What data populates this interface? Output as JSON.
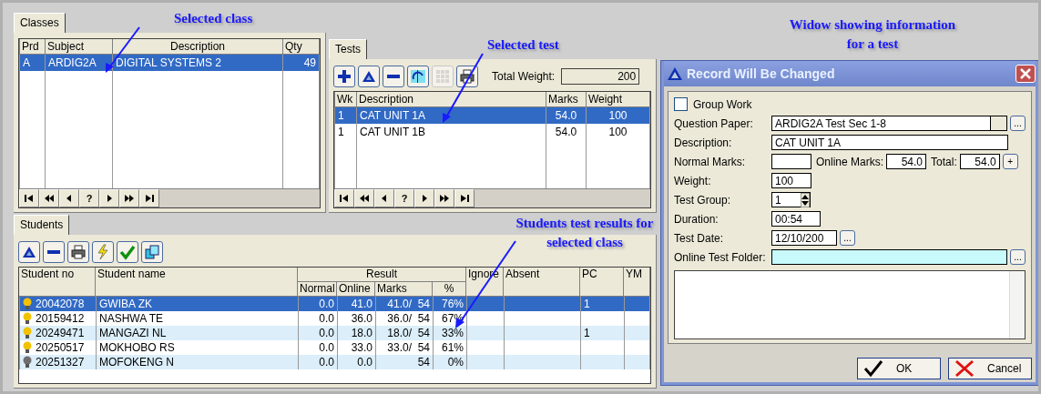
{
  "annotations": [
    {
      "text": "Selected class"
    },
    {
      "text": "Selected test"
    },
    {
      "text": "Widow showing information for a test"
    },
    {
      "text": "Students test results for selected class"
    }
  ],
  "classes": {
    "tab": {
      "label": "Classes",
      "selected": true
    },
    "columns": [
      "Prd",
      "Subject",
      "Description",
      "Qty"
    ],
    "rows": [
      {
        "cells": [
          "A",
          "ARDIG2A",
          "DIGITAL SYSTEMS 2",
          "49"
        ],
        "selected": true
      }
    ],
    "nav": [
      {
        "kind": "first"
      },
      {
        "kind": "prev-page"
      },
      {
        "kind": "prev"
      },
      {
        "kind": "find",
        "label": "?"
      },
      {
        "kind": "next"
      },
      {
        "kind": "next-page"
      },
      {
        "kind": "last"
      }
    ]
  },
  "tests": {
    "tab": {
      "label": "Tests",
      "selected": true
    },
    "toolbar": [
      {
        "kind": "add",
        "disabled": false
      },
      {
        "kind": "edit",
        "disabled": false
      },
      {
        "kind": "delete",
        "disabled": false
      },
      {
        "kind": "swap",
        "disabled": false
      },
      {
        "kind": "grid",
        "disabled": true
      },
      {
        "kind": "print",
        "disabled": false
      }
    ],
    "total_weight": {
      "label": "Total Weight:",
      "value": "200"
    },
    "columns": [
      "Wk",
      "Description",
      "Marks",
      "Weight"
    ],
    "rows": [
      {
        "cells": [
          "1",
          "CAT UNIT 1A",
          "54.0",
          "100"
        ],
        "selected": true
      },
      {
        "cells": [
          "1",
          "CAT UNIT 1B",
          "54.0",
          "100"
        ],
        "selected": false
      }
    ],
    "nav": [
      {
        "kind": "first"
      },
      {
        "kind": "prev-page"
      },
      {
        "kind": "prev"
      },
      {
        "kind": "find",
        "label": "?"
      },
      {
        "kind": "next"
      },
      {
        "kind": "next-page"
      },
      {
        "kind": "last"
      }
    ]
  },
  "students": {
    "tab": {
      "label": "Students",
      "selected": true
    },
    "toolbar": [
      {
        "kind": "edit"
      },
      {
        "kind": "delete"
      },
      {
        "kind": "print"
      },
      {
        "kind": "lightning"
      },
      {
        "kind": "check"
      },
      {
        "kind": "copy"
      }
    ],
    "columns": {
      "student_no": "Student no",
      "student_name": "Student name",
      "result": "Result",
      "normal": "Normal",
      "online": "Online",
      "marks": "Marks",
      "percent": "%",
      "ignore": "Ignore",
      "absent": "Absent",
      "pc": "PC",
      "ym": "YM"
    },
    "rows": [
      {
        "color": "#f2c200",
        "selected": true,
        "cells": [
          "20042078",
          "GWIBA  ZK",
          "0.0",
          "41.0",
          "41.0/  54",
          "76%",
          "",
          "",
          "1",
          ""
        ]
      },
      {
        "color": "#f2c200",
        "selected": false,
        "cells": [
          "20159412",
          "NASHWA TE",
          "0.0",
          "36.0",
          "36.0/  54",
          "67%",
          "",
          "",
          "",
          ""
        ]
      },
      {
        "color": "#f2c200",
        "selected": false,
        "cells": [
          "20249471",
          "MANGAZI  NL",
          "0.0",
          "18.0",
          "18.0/  54",
          "33%",
          "",
          "",
          "1",
          ""
        ]
      },
      {
        "color": "#f2c200",
        "selected": false,
        "cells": [
          "20250517",
          "MOKHOBO  RS",
          "0.0",
          "33.0",
          "33.0/  54",
          "61%",
          "",
          "",
          "",
          ""
        ]
      },
      {
        "color": "#6e6e6e",
        "selected": false,
        "cells": [
          "20251327",
          "MOFOKENG  N",
          "0.0",
          "0.0",
          "54",
          "0%",
          "",
          "",
          "",
          ""
        ]
      }
    ]
  },
  "dialog": {
    "title": "Record Will Be Changed",
    "group_work": {
      "label": "Group Work",
      "checked": false
    },
    "question_paper": {
      "label": "Question Paper:",
      "value": "ARDIG2A Test Sec 1-8"
    },
    "description": {
      "label": "Description:",
      "value": "CAT UNIT 1A"
    },
    "normal_marks": {
      "label": "Normal Marks:"
    },
    "online_marks": {
      "label": "Online Marks:",
      "value": "54.0"
    },
    "total": {
      "label": "Total:",
      "value": "54.0"
    },
    "weight": {
      "label": "Weight:",
      "value": "100"
    },
    "test_group": {
      "label": "Test Group:",
      "value": "1"
    },
    "duration": {
      "label": "Duration:",
      "value": "00:54"
    },
    "test_date": {
      "label": "Test Date:",
      "value": "12/10/200"
    },
    "online_test_folder": {
      "label": "Online Test Folder:"
    },
    "browse_label": "...",
    "plus_label": "+",
    "buttons": [
      {
        "kind": "ok",
        "label": "OK"
      },
      {
        "kind": "cancel",
        "label": "Cancel"
      }
    ]
  }
}
